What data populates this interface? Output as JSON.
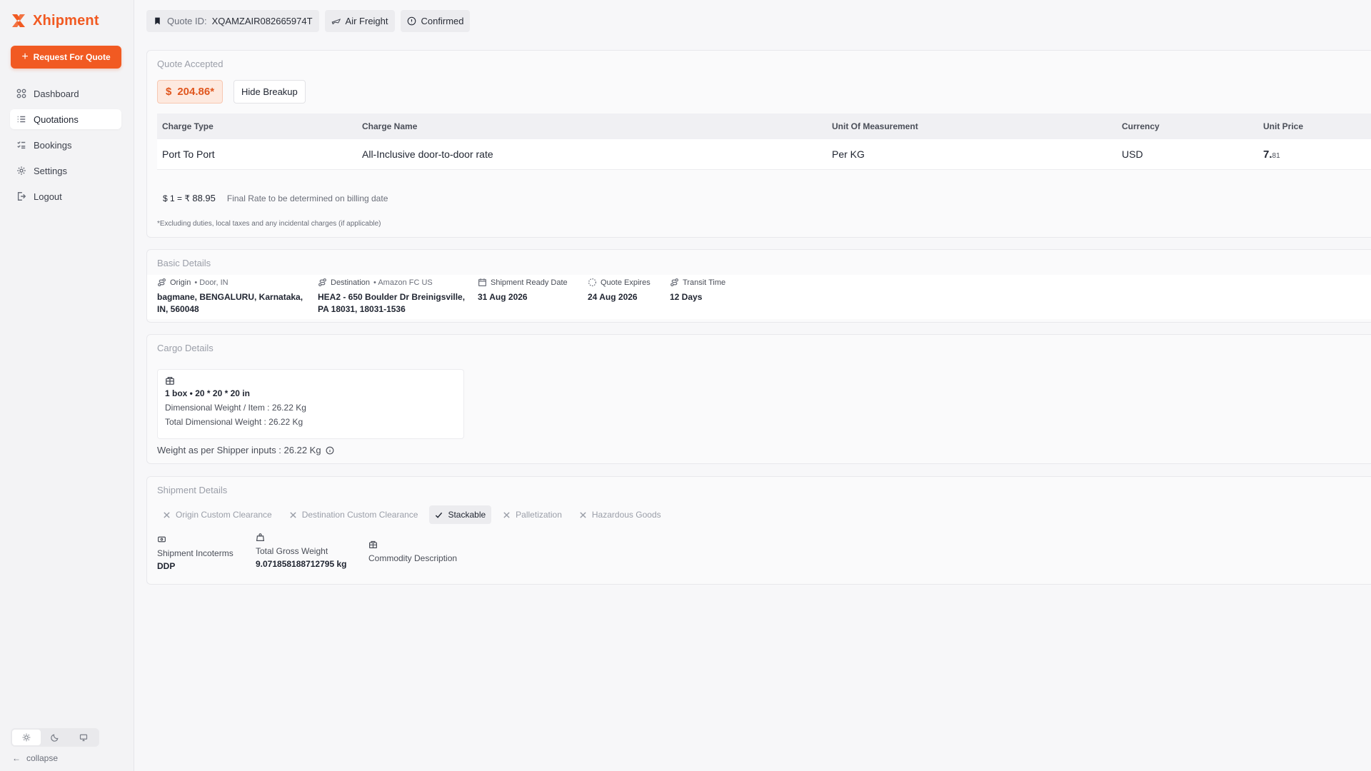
{
  "brand": {
    "name": "Xhipment",
    "color": "#f15a22"
  },
  "sidebar": {
    "cta_label": "Request For Quote",
    "items": [
      {
        "label": "Dashboard",
        "icon": "grid-icon",
        "active": false
      },
      {
        "label": "Quotations",
        "icon": "list-icon",
        "active": true
      },
      {
        "label": "Bookings",
        "icon": "checklist-icon",
        "active": false
      },
      {
        "label": "Settings",
        "icon": "gear-icon",
        "active": false
      },
      {
        "label": "Logout",
        "icon": "logout-icon",
        "active": false
      }
    ],
    "theme_options": [
      "sun-icon",
      "moon-icon",
      "monitor-icon"
    ],
    "collapse_label": "collapse"
  },
  "header": {
    "quote_id_label": "Quote ID:",
    "quote_id": "XQAMZAIR082665974T",
    "mode": "Air Freight",
    "status": "Confirmed"
  },
  "quote": {
    "section_title": "Quote Accepted",
    "price": "204.86*",
    "currency_symbol": "$",
    "hide_breakup_label": "Hide Breakup",
    "columns": [
      "Charge Type",
      "Charge Name",
      "Unit Of Measurement",
      "Currency",
      "Unit Price"
    ],
    "rows": [
      {
        "charge_type": "Port To Port",
        "charge_name": "All-Inclusive door-to-door rate",
        "uom": "Per KG",
        "currency": "USD",
        "unit_price_main": "7.",
        "unit_price_decimals": "81"
      }
    ],
    "fx_prefix": "$ 1 = ₹",
    "fx_rate": "88.95",
    "fx_note": "Final Rate to be determined on billing date",
    "exclusion_note": "*Excluding duties, local taxes and any incidental charges (if applicable)"
  },
  "basic": {
    "section_title": "Basic Details",
    "origin_label": "Origin",
    "origin_sub": "• Door, IN",
    "origin_value_1": "bagmane, BENGALURU, Karnataka,",
    "origin_value_2": "IN, 560048",
    "destination_label": "Destination",
    "destination_sub": "• Amazon FC US",
    "destination_value_1": "HEA2 - 650 Boulder Dr Breinigsville,",
    "destination_value_2": "PA 18031, 18031-1536",
    "ready_label": "Shipment Ready Date",
    "ready_value": "31 Aug 2026",
    "expires_label": "Quote Expires",
    "expires_value": "24 Aug 2026",
    "transit_label": "Transit Time",
    "transit_value": "12 Days"
  },
  "cargo": {
    "section_title": "Cargo Details",
    "summary": "1 box • 20 * 20 * 20 in",
    "dim_weight_item": "Dimensional Weight / Item : 26.22 Kg",
    "total_dim_weight": "Total Dimensional Weight : 26.22 Kg",
    "shipper_weight": "Weight as per Shipper inputs : 26.22 Kg"
  },
  "shipment": {
    "section_title": "Shipment Details",
    "chips": [
      {
        "label": "Origin Custom Clearance",
        "on": false
      },
      {
        "label": "Destination Custom Clearance",
        "on": false
      },
      {
        "label": "Stackable",
        "on": true
      },
      {
        "label": "Palletization",
        "on": false
      },
      {
        "label": "Hazardous Goods",
        "on": false
      }
    ],
    "incoterms_label": "Shipment Incoterms",
    "incoterms_value": "DDP",
    "gross_weight_label": "Total Gross Weight",
    "gross_weight_value": "9.071858188712795 kg",
    "commodity_label": "Commodity Description"
  }
}
